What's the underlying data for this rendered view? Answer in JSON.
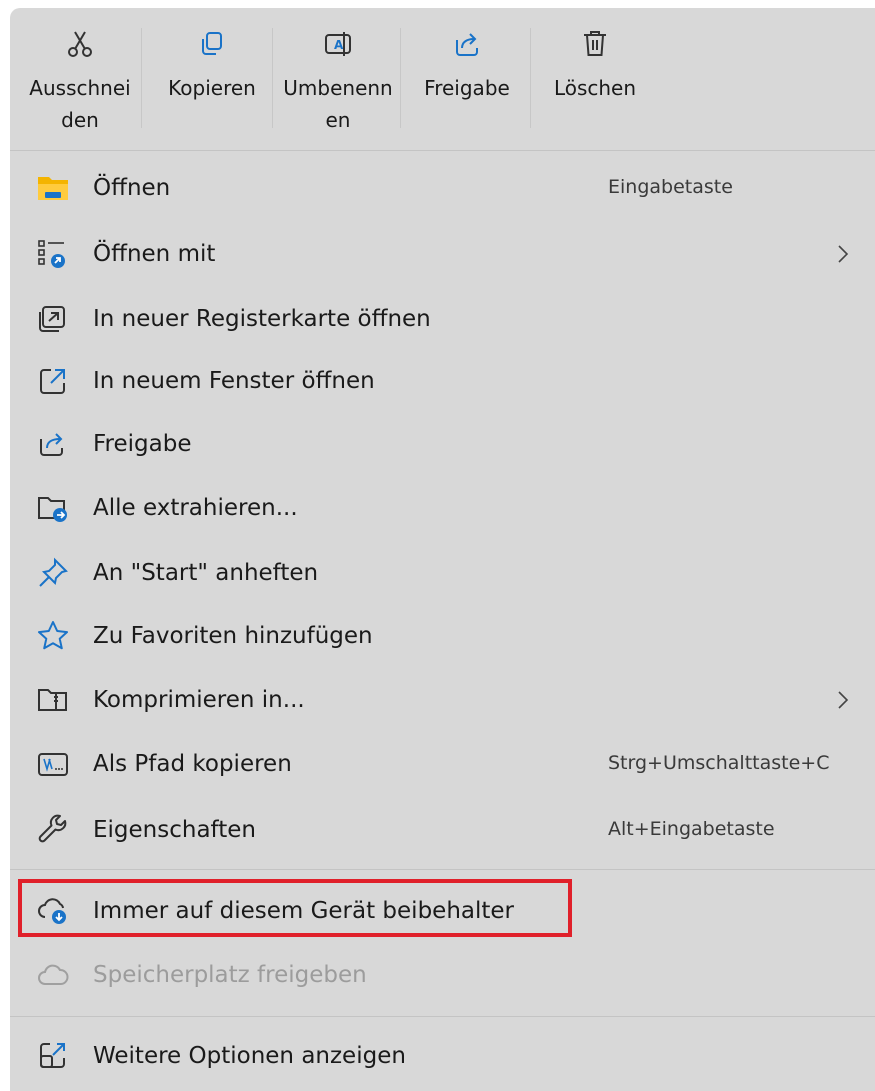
{
  "toolbar": {
    "cut": "Ausschnei\nden",
    "copy": "Kopieren",
    "rename": "Umbenenn\nen",
    "share": "Freigabe",
    "delete": "Löschen"
  },
  "items": [
    {
      "label": "Öffnen",
      "shortcut": "Eingabetaste",
      "icon": "folder-open-icon"
    },
    {
      "label": "Öffnen mit",
      "icon": "open-with-icon",
      "submenu": true
    },
    {
      "label": "In neuer Registerkarte öffnen",
      "icon": "new-tab-icon"
    },
    {
      "label": "In neuem Fenster öffnen",
      "icon": "new-window-icon"
    },
    {
      "label": "Freigabe",
      "icon": "share-icon"
    },
    {
      "label": "Alle extrahieren...",
      "icon": "extract-icon"
    },
    {
      "label": "An \"Start\" anheften",
      "icon": "pin-icon"
    },
    {
      "label": "Zu Favoriten hinzufügen",
      "icon": "star-icon"
    },
    {
      "label": "Komprimieren in...",
      "icon": "zip-folder-icon",
      "submenu": true
    },
    {
      "label": "Als Pfad kopieren",
      "shortcut": "Strg+Umschalttaste+C",
      "icon": "copy-path-icon"
    },
    {
      "label": "Eigenschaften",
      "shortcut": "Alt+Eingabetaste",
      "icon": "wrench-icon"
    },
    {
      "label": "Immer auf diesem Gerät beibehalter",
      "icon": "cloud-download-icon"
    },
    {
      "label": "Speicherplatz freigeben",
      "icon": "cloud-icon",
      "disabled": true
    },
    {
      "label": "Weitere Optionen anzeigen",
      "icon": "more-options-icon"
    }
  ],
  "colors": {
    "menu_bg": "#d8d8d8",
    "accent": "#1a73c8",
    "highlight_border": "#e0202a",
    "folder_yellow": "#f4b400"
  }
}
